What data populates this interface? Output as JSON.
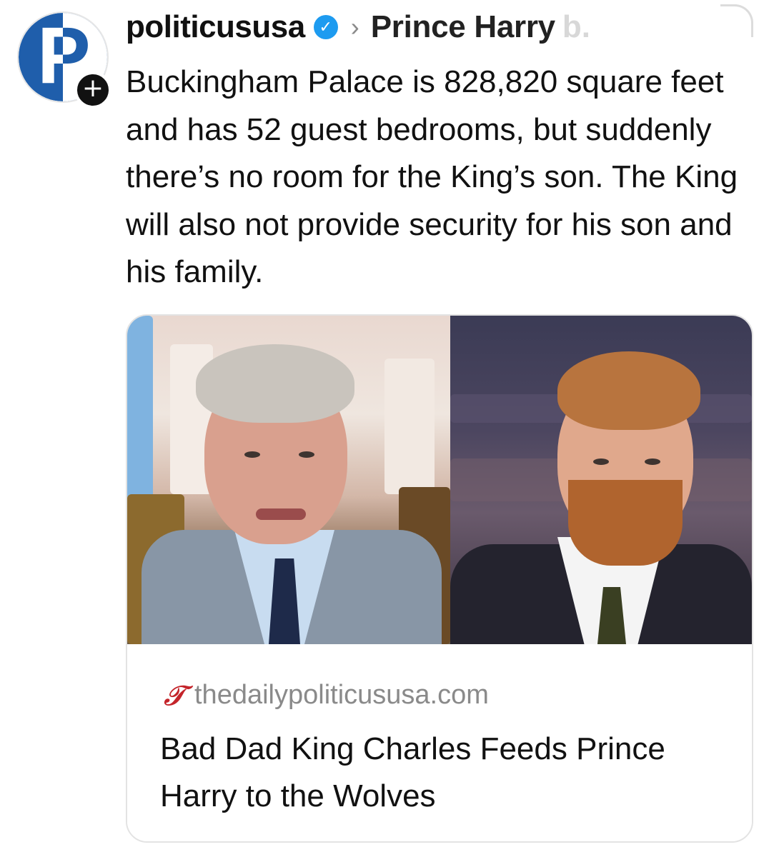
{
  "post": {
    "username": "politicususa",
    "topic": "Prince Harry",
    "topic_overflow": "b.",
    "caption": "Buckingham Palace is 828,820 square feet and has 52 guest bedrooms, but suddenly there’s no room for the King’s son. The King will also not provide security for his son and his family."
  },
  "avatar": {
    "letter": "P",
    "follow_glyph": "+"
  },
  "icons": {
    "verified": "✓",
    "chevron": "›",
    "site": "𝒯"
  },
  "link_card": {
    "domain": "thedailypoliticususa.com",
    "headline": "Bad Dad King Charles Feeds Prince Harry to the Wolves"
  },
  "colors": {
    "brand": "#1f5eab",
    "verified": "#1d9bf0",
    "site_icon": "#c4242a"
  }
}
